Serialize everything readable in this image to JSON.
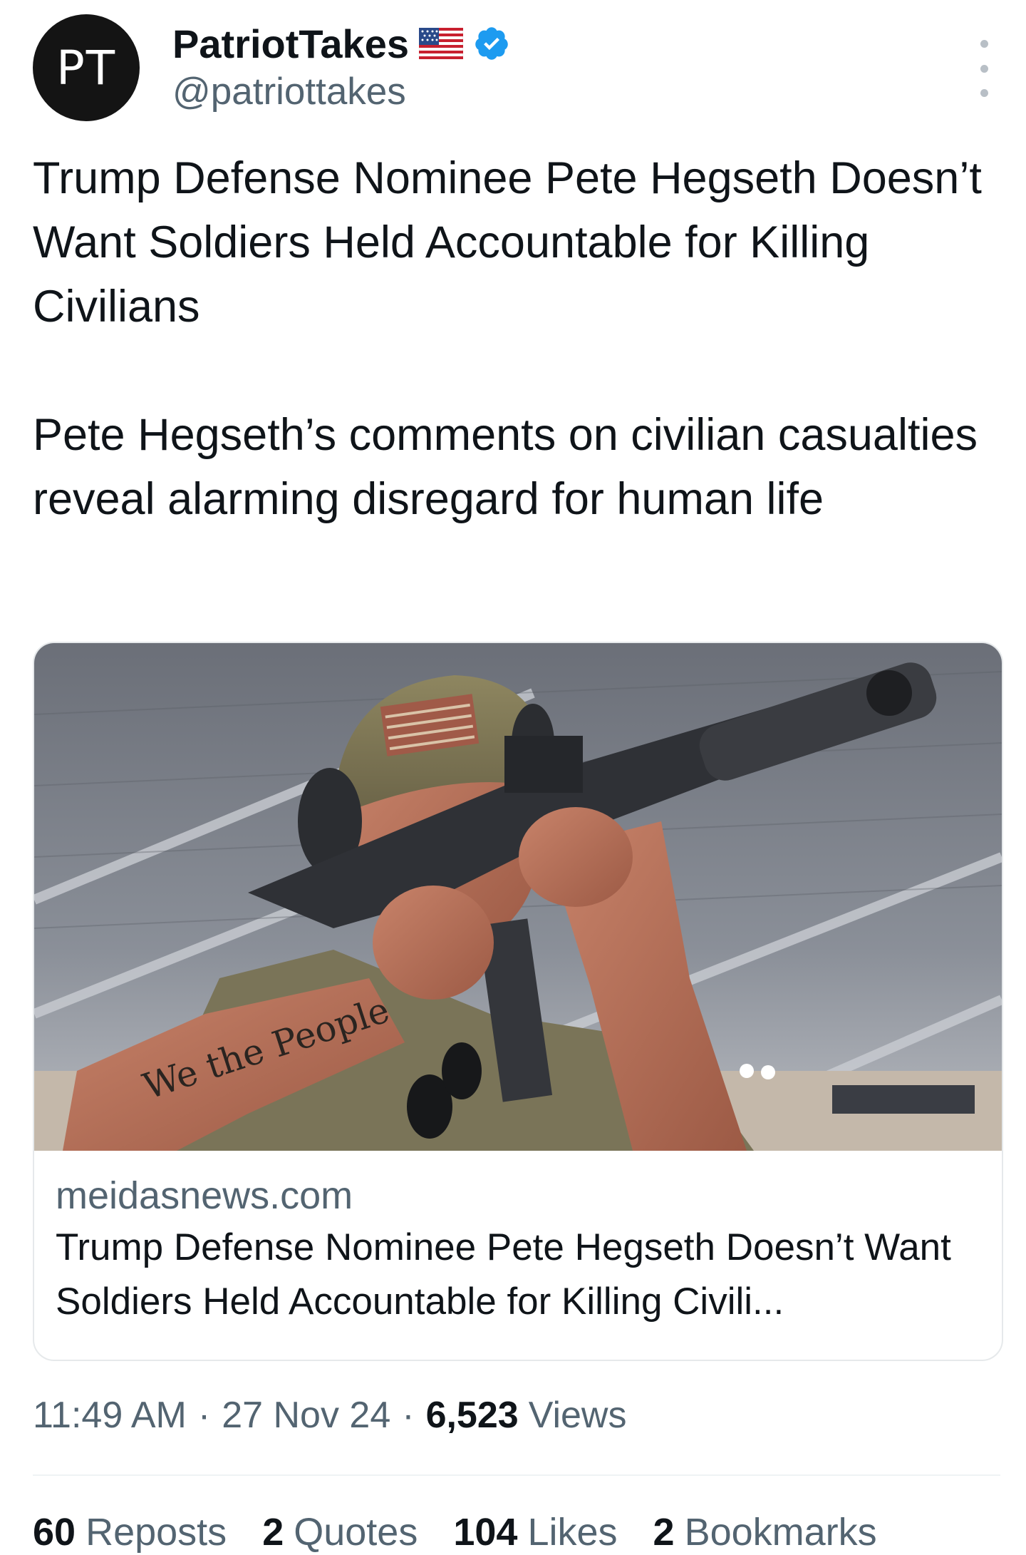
{
  "tweet": {
    "avatar_text": "PT",
    "display_name": "PatriotTakes",
    "handle": "@patriottakes",
    "body": "Trump Defense Nominee Pete Hegseth Doesn’t Want Soldiers Held Accountable for Killing Civilians\n\nPete Hegseth’s comments on civilian casualties reveal alarming disregard for human life"
  },
  "card": {
    "domain": "meidasnews.com",
    "title": "Trump Defense Nominee Pete Hegseth Doesn’t Want Soldiers Held Accountable for Killing Civili...",
    "tattoo_text": "We the People"
  },
  "meta": {
    "time": "11:49 AM",
    "date": "27 Nov 24",
    "views_count": "6,523",
    "views_label": "Views",
    "separator": "·"
  },
  "stats": {
    "reposts_count": "60",
    "reposts_label": "Reposts",
    "quotes_count": "2",
    "quotes_label": "Quotes",
    "likes_count": "104",
    "likes_label": "Likes",
    "bookmarks_count": "2",
    "bookmarks_label": "Bookmarks"
  },
  "colors": {
    "verified_blue": "#1d9bf0",
    "secondary_text": "#536471",
    "primary_text": "#0f1419"
  },
  "icons": [
    "us-flag-icon",
    "verified-badge-icon",
    "more-options-icon"
  ]
}
